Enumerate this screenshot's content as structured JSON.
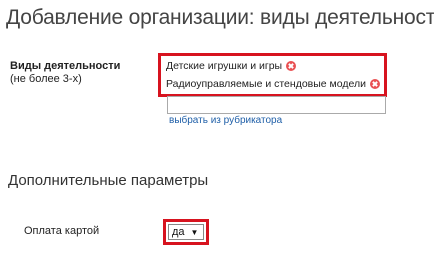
{
  "header": {
    "title": "Добавление организации: виды деятельности"
  },
  "activities": {
    "label": "Виды деятельности",
    "hint": "(не более 3-х)",
    "tags": [
      {
        "label": "Детские игрушки и игры",
        "remove_icon": "remove-circle-icon"
      },
      {
        "label": "Радиоуправляемые и стендовые модели",
        "remove_icon": "remove-circle-icon"
      }
    ],
    "input_value": "",
    "rubricator_link": "выбрать из рубрикатора"
  },
  "additional": {
    "title": "Дополнительные параметры",
    "card_payment": {
      "label": "Оплата картой",
      "selected_value": "да",
      "arrow_icon": "dropdown-arrow-icon"
    }
  },
  "colors": {
    "highlight_border": "#d7131f",
    "remove_icon": "#e95052",
    "link": "#1f5fa8"
  }
}
